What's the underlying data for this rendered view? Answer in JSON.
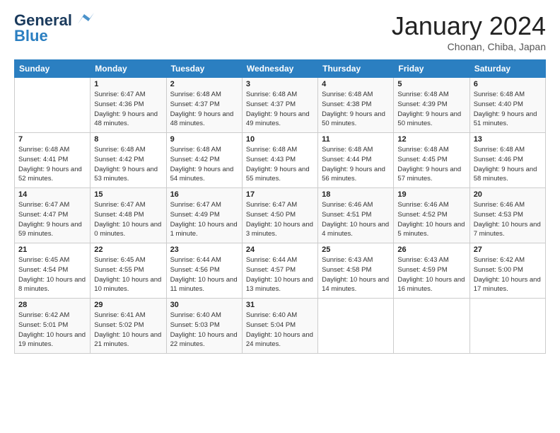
{
  "header": {
    "logo_general": "General",
    "logo_blue": "Blue",
    "month_title": "January 2024",
    "location": "Chonan, Chiba, Japan"
  },
  "columns": [
    "Sunday",
    "Monday",
    "Tuesday",
    "Wednesday",
    "Thursday",
    "Friday",
    "Saturday"
  ],
  "weeks": [
    {
      "cells": [
        {
          "day": "",
          "sunrise": "",
          "sunset": "",
          "daylight": ""
        },
        {
          "day": "1",
          "sunrise": "Sunrise: 6:47 AM",
          "sunset": "Sunset: 4:36 PM",
          "daylight": "Daylight: 9 hours and 48 minutes."
        },
        {
          "day": "2",
          "sunrise": "Sunrise: 6:48 AM",
          "sunset": "Sunset: 4:37 PM",
          "daylight": "Daylight: 9 hours and 48 minutes."
        },
        {
          "day": "3",
          "sunrise": "Sunrise: 6:48 AM",
          "sunset": "Sunset: 4:37 PM",
          "daylight": "Daylight: 9 hours and 49 minutes."
        },
        {
          "day": "4",
          "sunrise": "Sunrise: 6:48 AM",
          "sunset": "Sunset: 4:38 PM",
          "daylight": "Daylight: 9 hours and 50 minutes."
        },
        {
          "day": "5",
          "sunrise": "Sunrise: 6:48 AM",
          "sunset": "Sunset: 4:39 PM",
          "daylight": "Daylight: 9 hours and 50 minutes."
        },
        {
          "day": "6",
          "sunrise": "Sunrise: 6:48 AM",
          "sunset": "Sunset: 4:40 PM",
          "daylight": "Daylight: 9 hours and 51 minutes."
        }
      ]
    },
    {
      "cells": [
        {
          "day": "7",
          "sunrise": "Sunrise: 6:48 AM",
          "sunset": "Sunset: 4:41 PM",
          "daylight": "Daylight: 9 hours and 52 minutes."
        },
        {
          "day": "8",
          "sunrise": "Sunrise: 6:48 AM",
          "sunset": "Sunset: 4:42 PM",
          "daylight": "Daylight: 9 hours and 53 minutes."
        },
        {
          "day": "9",
          "sunrise": "Sunrise: 6:48 AM",
          "sunset": "Sunset: 4:42 PM",
          "daylight": "Daylight: 9 hours and 54 minutes."
        },
        {
          "day": "10",
          "sunrise": "Sunrise: 6:48 AM",
          "sunset": "Sunset: 4:43 PM",
          "daylight": "Daylight: 9 hours and 55 minutes."
        },
        {
          "day": "11",
          "sunrise": "Sunrise: 6:48 AM",
          "sunset": "Sunset: 4:44 PM",
          "daylight": "Daylight: 9 hours and 56 minutes."
        },
        {
          "day": "12",
          "sunrise": "Sunrise: 6:48 AM",
          "sunset": "Sunset: 4:45 PM",
          "daylight": "Daylight: 9 hours and 57 minutes."
        },
        {
          "day": "13",
          "sunrise": "Sunrise: 6:48 AM",
          "sunset": "Sunset: 4:46 PM",
          "daylight": "Daylight: 9 hours and 58 minutes."
        }
      ]
    },
    {
      "cells": [
        {
          "day": "14",
          "sunrise": "Sunrise: 6:47 AM",
          "sunset": "Sunset: 4:47 PM",
          "daylight": "Daylight: 9 hours and 59 minutes."
        },
        {
          "day": "15",
          "sunrise": "Sunrise: 6:47 AM",
          "sunset": "Sunset: 4:48 PM",
          "daylight": "Daylight: 10 hours and 0 minutes."
        },
        {
          "day": "16",
          "sunrise": "Sunrise: 6:47 AM",
          "sunset": "Sunset: 4:49 PM",
          "daylight": "Daylight: 10 hours and 1 minute."
        },
        {
          "day": "17",
          "sunrise": "Sunrise: 6:47 AM",
          "sunset": "Sunset: 4:50 PM",
          "daylight": "Daylight: 10 hours and 3 minutes."
        },
        {
          "day": "18",
          "sunrise": "Sunrise: 6:46 AM",
          "sunset": "Sunset: 4:51 PM",
          "daylight": "Daylight: 10 hours and 4 minutes."
        },
        {
          "day": "19",
          "sunrise": "Sunrise: 6:46 AM",
          "sunset": "Sunset: 4:52 PM",
          "daylight": "Daylight: 10 hours and 5 minutes."
        },
        {
          "day": "20",
          "sunrise": "Sunrise: 6:46 AM",
          "sunset": "Sunset: 4:53 PM",
          "daylight": "Daylight: 10 hours and 7 minutes."
        }
      ]
    },
    {
      "cells": [
        {
          "day": "21",
          "sunrise": "Sunrise: 6:45 AM",
          "sunset": "Sunset: 4:54 PM",
          "daylight": "Daylight: 10 hours and 8 minutes."
        },
        {
          "day": "22",
          "sunrise": "Sunrise: 6:45 AM",
          "sunset": "Sunset: 4:55 PM",
          "daylight": "Daylight: 10 hours and 10 minutes."
        },
        {
          "day": "23",
          "sunrise": "Sunrise: 6:44 AM",
          "sunset": "Sunset: 4:56 PM",
          "daylight": "Daylight: 10 hours and 11 minutes."
        },
        {
          "day": "24",
          "sunrise": "Sunrise: 6:44 AM",
          "sunset": "Sunset: 4:57 PM",
          "daylight": "Daylight: 10 hours and 13 minutes."
        },
        {
          "day": "25",
          "sunrise": "Sunrise: 6:43 AM",
          "sunset": "Sunset: 4:58 PM",
          "daylight": "Daylight: 10 hours and 14 minutes."
        },
        {
          "day": "26",
          "sunrise": "Sunrise: 6:43 AM",
          "sunset": "Sunset: 4:59 PM",
          "daylight": "Daylight: 10 hours and 16 minutes."
        },
        {
          "day": "27",
          "sunrise": "Sunrise: 6:42 AM",
          "sunset": "Sunset: 5:00 PM",
          "daylight": "Daylight: 10 hours and 17 minutes."
        }
      ]
    },
    {
      "cells": [
        {
          "day": "28",
          "sunrise": "Sunrise: 6:42 AM",
          "sunset": "Sunset: 5:01 PM",
          "daylight": "Daylight: 10 hours and 19 minutes."
        },
        {
          "day": "29",
          "sunrise": "Sunrise: 6:41 AM",
          "sunset": "Sunset: 5:02 PM",
          "daylight": "Daylight: 10 hours and 21 minutes."
        },
        {
          "day": "30",
          "sunrise": "Sunrise: 6:40 AM",
          "sunset": "Sunset: 5:03 PM",
          "daylight": "Daylight: 10 hours and 22 minutes."
        },
        {
          "day": "31",
          "sunrise": "Sunrise: 6:40 AM",
          "sunset": "Sunset: 5:04 PM",
          "daylight": "Daylight: 10 hours and 24 minutes."
        },
        {
          "day": "",
          "sunrise": "",
          "sunset": "",
          "daylight": ""
        },
        {
          "day": "",
          "sunrise": "",
          "sunset": "",
          "daylight": ""
        },
        {
          "day": "",
          "sunrise": "",
          "sunset": "",
          "daylight": ""
        }
      ]
    }
  ]
}
